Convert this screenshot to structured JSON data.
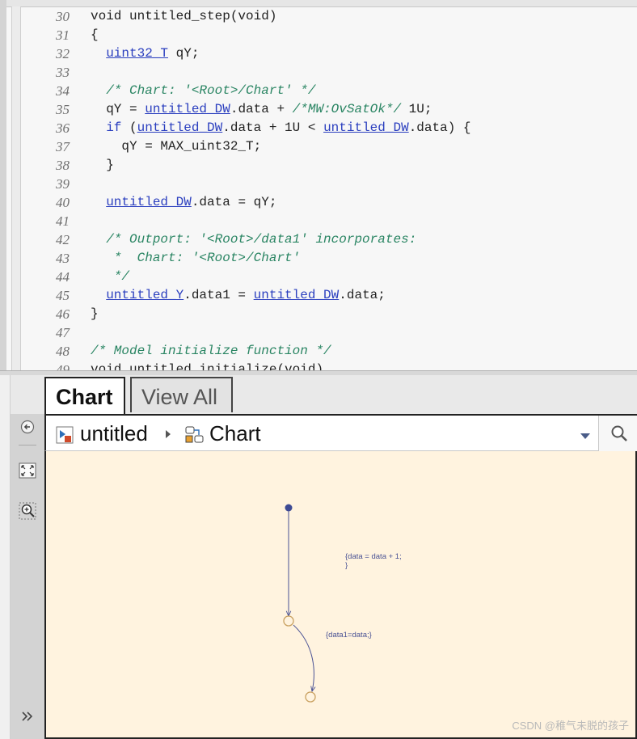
{
  "code": {
    "lines": [
      {
        "n": "30",
        "parts": [
          {
            "t": "void untitled_step(void)",
            "c": "plain"
          }
        ]
      },
      {
        "n": "31",
        "parts": [
          {
            "t": "{",
            "c": "plain"
          }
        ]
      },
      {
        "n": "32",
        "parts": [
          {
            "t": "  ",
            "c": "plain"
          },
          {
            "t": "uint32_T",
            "c": "link"
          },
          {
            "t": " qY;",
            "c": "plain"
          }
        ]
      },
      {
        "n": "33",
        "parts": []
      },
      {
        "n": "34",
        "parts": [
          {
            "t": "  ",
            "c": "plain"
          },
          {
            "t": "/* Chart: '<Root>/Chart' */",
            "c": "cmt"
          }
        ]
      },
      {
        "n": "35",
        "parts": [
          {
            "t": "  qY = ",
            "c": "plain"
          },
          {
            "t": "untitled_DW",
            "c": "link"
          },
          {
            "t": ".data + ",
            "c": "plain"
          },
          {
            "t": "/*MW:OvSatOk*/",
            "c": "cmt"
          },
          {
            "t": " 1U;",
            "c": "plain"
          }
        ]
      },
      {
        "n": "36",
        "parts": [
          {
            "t": "  ",
            "c": "plain"
          },
          {
            "t": "if",
            "c": "kw"
          },
          {
            "t": " (",
            "c": "plain"
          },
          {
            "t": "untitled_DW",
            "c": "link"
          },
          {
            "t": ".data + 1U < ",
            "c": "plain"
          },
          {
            "t": "untitled_DW",
            "c": "link"
          },
          {
            "t": ".data) {",
            "c": "plain"
          }
        ]
      },
      {
        "n": "37",
        "parts": [
          {
            "t": "    qY = MAX_uint32_T;",
            "c": "plain"
          }
        ]
      },
      {
        "n": "38",
        "parts": [
          {
            "t": "  }",
            "c": "plain"
          }
        ]
      },
      {
        "n": "39",
        "parts": []
      },
      {
        "n": "40",
        "parts": [
          {
            "t": "  ",
            "c": "plain"
          },
          {
            "t": "untitled_DW",
            "c": "link"
          },
          {
            "t": ".data = qY;",
            "c": "plain"
          }
        ]
      },
      {
        "n": "41",
        "parts": []
      },
      {
        "n": "42",
        "parts": [
          {
            "t": "  ",
            "c": "plain"
          },
          {
            "t": "/* Outport: '<Root>/data1' incorporates:",
            "c": "cmt"
          }
        ]
      },
      {
        "n": "43",
        "parts": [
          {
            "t": "   *  Chart: '<Root>/Chart'",
            "c": "cmt"
          }
        ]
      },
      {
        "n": "44",
        "parts": [
          {
            "t": "   */",
            "c": "cmt"
          }
        ]
      },
      {
        "n": "45",
        "parts": [
          {
            "t": "  ",
            "c": "plain"
          },
          {
            "t": "untitled_Y",
            "c": "link"
          },
          {
            "t": ".data1 = ",
            "c": "plain"
          },
          {
            "t": "untitled_DW",
            "c": "link"
          },
          {
            "t": ".data;",
            "c": "plain"
          }
        ]
      },
      {
        "n": "46",
        "parts": [
          {
            "t": "}",
            "c": "plain"
          }
        ]
      },
      {
        "n": "47",
        "parts": []
      },
      {
        "n": "48",
        "parts": [
          {
            "t": "/* Model initialize function */",
            "c": "cmt"
          }
        ]
      },
      {
        "n": "49",
        "parts": [
          {
            "t": "void untitled_initialize(void)",
            "c": "plain"
          }
        ]
      }
    ]
  },
  "tabs": [
    {
      "label": "Chart",
      "active": true
    },
    {
      "label": "View All",
      "active": false
    }
  ],
  "breadcrumb": {
    "model": "untitled",
    "chart": "Chart"
  },
  "palette_icons": [
    "back-arrow-icon",
    "fit-to-view-icon",
    "zoom-in-icon",
    "expand-chevrons-icon"
  ],
  "diagram": {
    "transition1_label_line1": "{data = data + 1;",
    "transition1_label_line2": "}",
    "transition2_label": "{data1=data;}"
  },
  "watermark": "CSDN @稚气未脱的孩子",
  "colors": {
    "canvas_bg": "#fff3df",
    "state_stroke": "#c9a060",
    "transition_stroke": "#4a5294",
    "link": "#2b3fbf",
    "comment": "#2a8563"
  }
}
